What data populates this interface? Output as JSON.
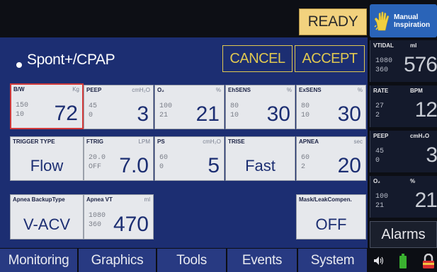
{
  "header": {
    "status": "READY",
    "manual_inspiration": "Manual Inspiration",
    "manual_line1": "Manual",
    "manual_line2": "Inspiration"
  },
  "mode": {
    "label": "Spont+/CPAP",
    "cancel": "CANCEL",
    "accept": "ACCEPT"
  },
  "settings": {
    "bw": {
      "label": "B/W",
      "unit": "Kg",
      "hi": "150",
      "lo": "10",
      "value": "72"
    },
    "peep": {
      "label": "PEEP",
      "unit": "cmH₂O",
      "hi": "45",
      "lo": "0",
      "value": "3"
    },
    "o2": {
      "label": "O₂",
      "unit": "%",
      "hi": "100",
      "lo": "21",
      "value": "21"
    },
    "ehsens": {
      "label": "EhSENS",
      "unit": "%",
      "hi": "80",
      "lo": "10",
      "value": "30"
    },
    "exsens": {
      "label": "ExSENS",
      "unit": "%",
      "hi": "80",
      "lo": "10",
      "value": "30"
    },
    "trigger": {
      "label": "TRIGGER TYPE",
      "value": "Flow"
    },
    "ftrig": {
      "label": "FTRIG",
      "unit": "LPM",
      "hi": "20.0",
      "lo": "OFF",
      "value": "7.0"
    },
    "ps": {
      "label": "PS",
      "unit": "cmH₂O",
      "hi": "60",
      "lo": "0",
      "value": "5"
    },
    "trise": {
      "label": "TRISE",
      "value": "Fast"
    },
    "apnea": {
      "label": "APNEA",
      "unit": "sec",
      "hi": "60",
      "lo": "2",
      "value": "20"
    },
    "backup": {
      "label": "Apnea BackupType",
      "value": "V-ACV"
    },
    "apnea_vt": {
      "label": "Apnea VT",
      "unit": "ml",
      "hi": "1080",
      "lo": "360",
      "value": "470"
    },
    "mask": {
      "label": "Mask/LeakCompen.",
      "value": "OFF"
    }
  },
  "monitor": {
    "vtidal": {
      "label": "VTIDAL",
      "unit": "ml",
      "hi": "1080",
      "lo": "360",
      "value": "576"
    },
    "rate": {
      "label": "RATE",
      "unit": "BPM",
      "hi": "27",
      "lo": "2",
      "value": "12"
    },
    "peep": {
      "label": "PEEP",
      "unit": "cmH₂O",
      "hi": "45",
      "lo": "0",
      "value": "3"
    },
    "o2": {
      "label": "O₂",
      "unit": "%",
      "hi": "100",
      "lo": "21",
      "value": "21"
    },
    "alarms": "Alarms"
  },
  "nav": {
    "tabs": [
      {
        "label": "Monitoring"
      },
      {
        "label": "Graphics"
      },
      {
        "label": "Tools"
      },
      {
        "label": "Events"
      },
      {
        "label": "System"
      }
    ]
  },
  "icons": [
    "hand-icon",
    "speaker-icon",
    "battery-icon",
    "lock-icon"
  ],
  "colors": {
    "panel": "#1c2e72",
    "ready": "#f2d27e",
    "accent_yellow": "#e0c850",
    "selected_border": "#d23a3a",
    "manual_button": "#2a64b8"
  }
}
